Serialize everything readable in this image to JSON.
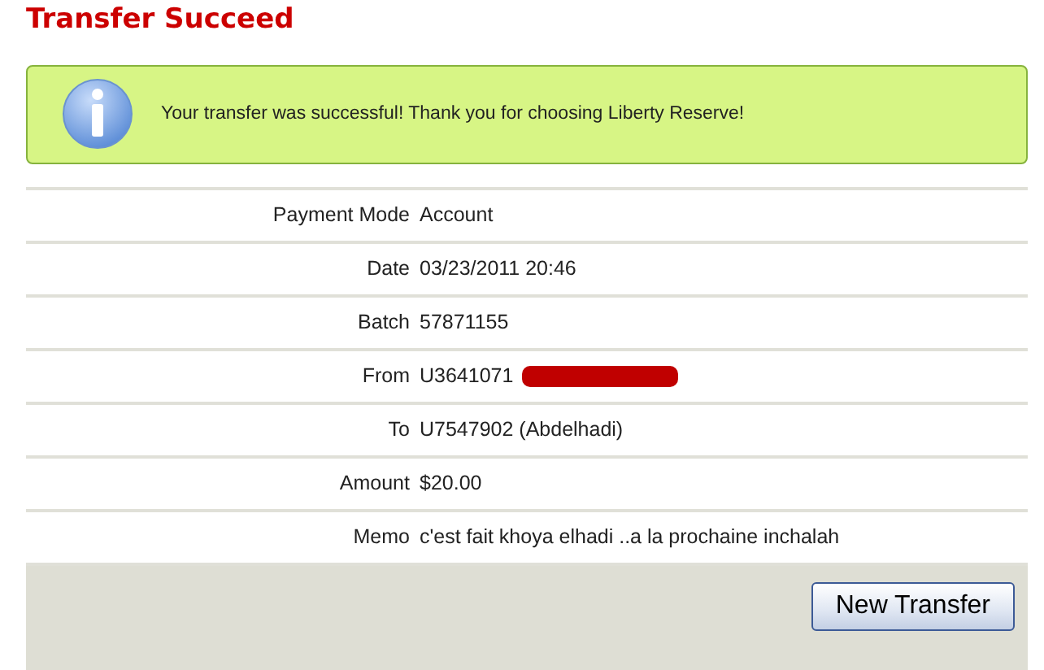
{
  "title": "Transfer Succeed",
  "notice": {
    "message": "Your transfer was successful! Thank you for choosing Liberty Reserve!"
  },
  "details": [
    {
      "label": "Payment Mode",
      "value": "Account",
      "redacted": false
    },
    {
      "label": "Date",
      "value": "03/23/2011 20:46",
      "redacted": false
    },
    {
      "label": "Batch",
      "value": "57871155",
      "redacted": false
    },
    {
      "label": "From",
      "value": "U3641071",
      "redacted": true
    },
    {
      "label": "To",
      "value": "U7547902 (Abdelhadi)",
      "redacted": false
    },
    {
      "label": "Amount",
      "value": "$20.00",
      "redacted": false
    },
    {
      "label": "Memo",
      "value": "c'est fait khoya elhadi ..a la prochaine inchalah",
      "redacted": false
    }
  ],
  "buttons": [
    "New Transfer"
  ]
}
